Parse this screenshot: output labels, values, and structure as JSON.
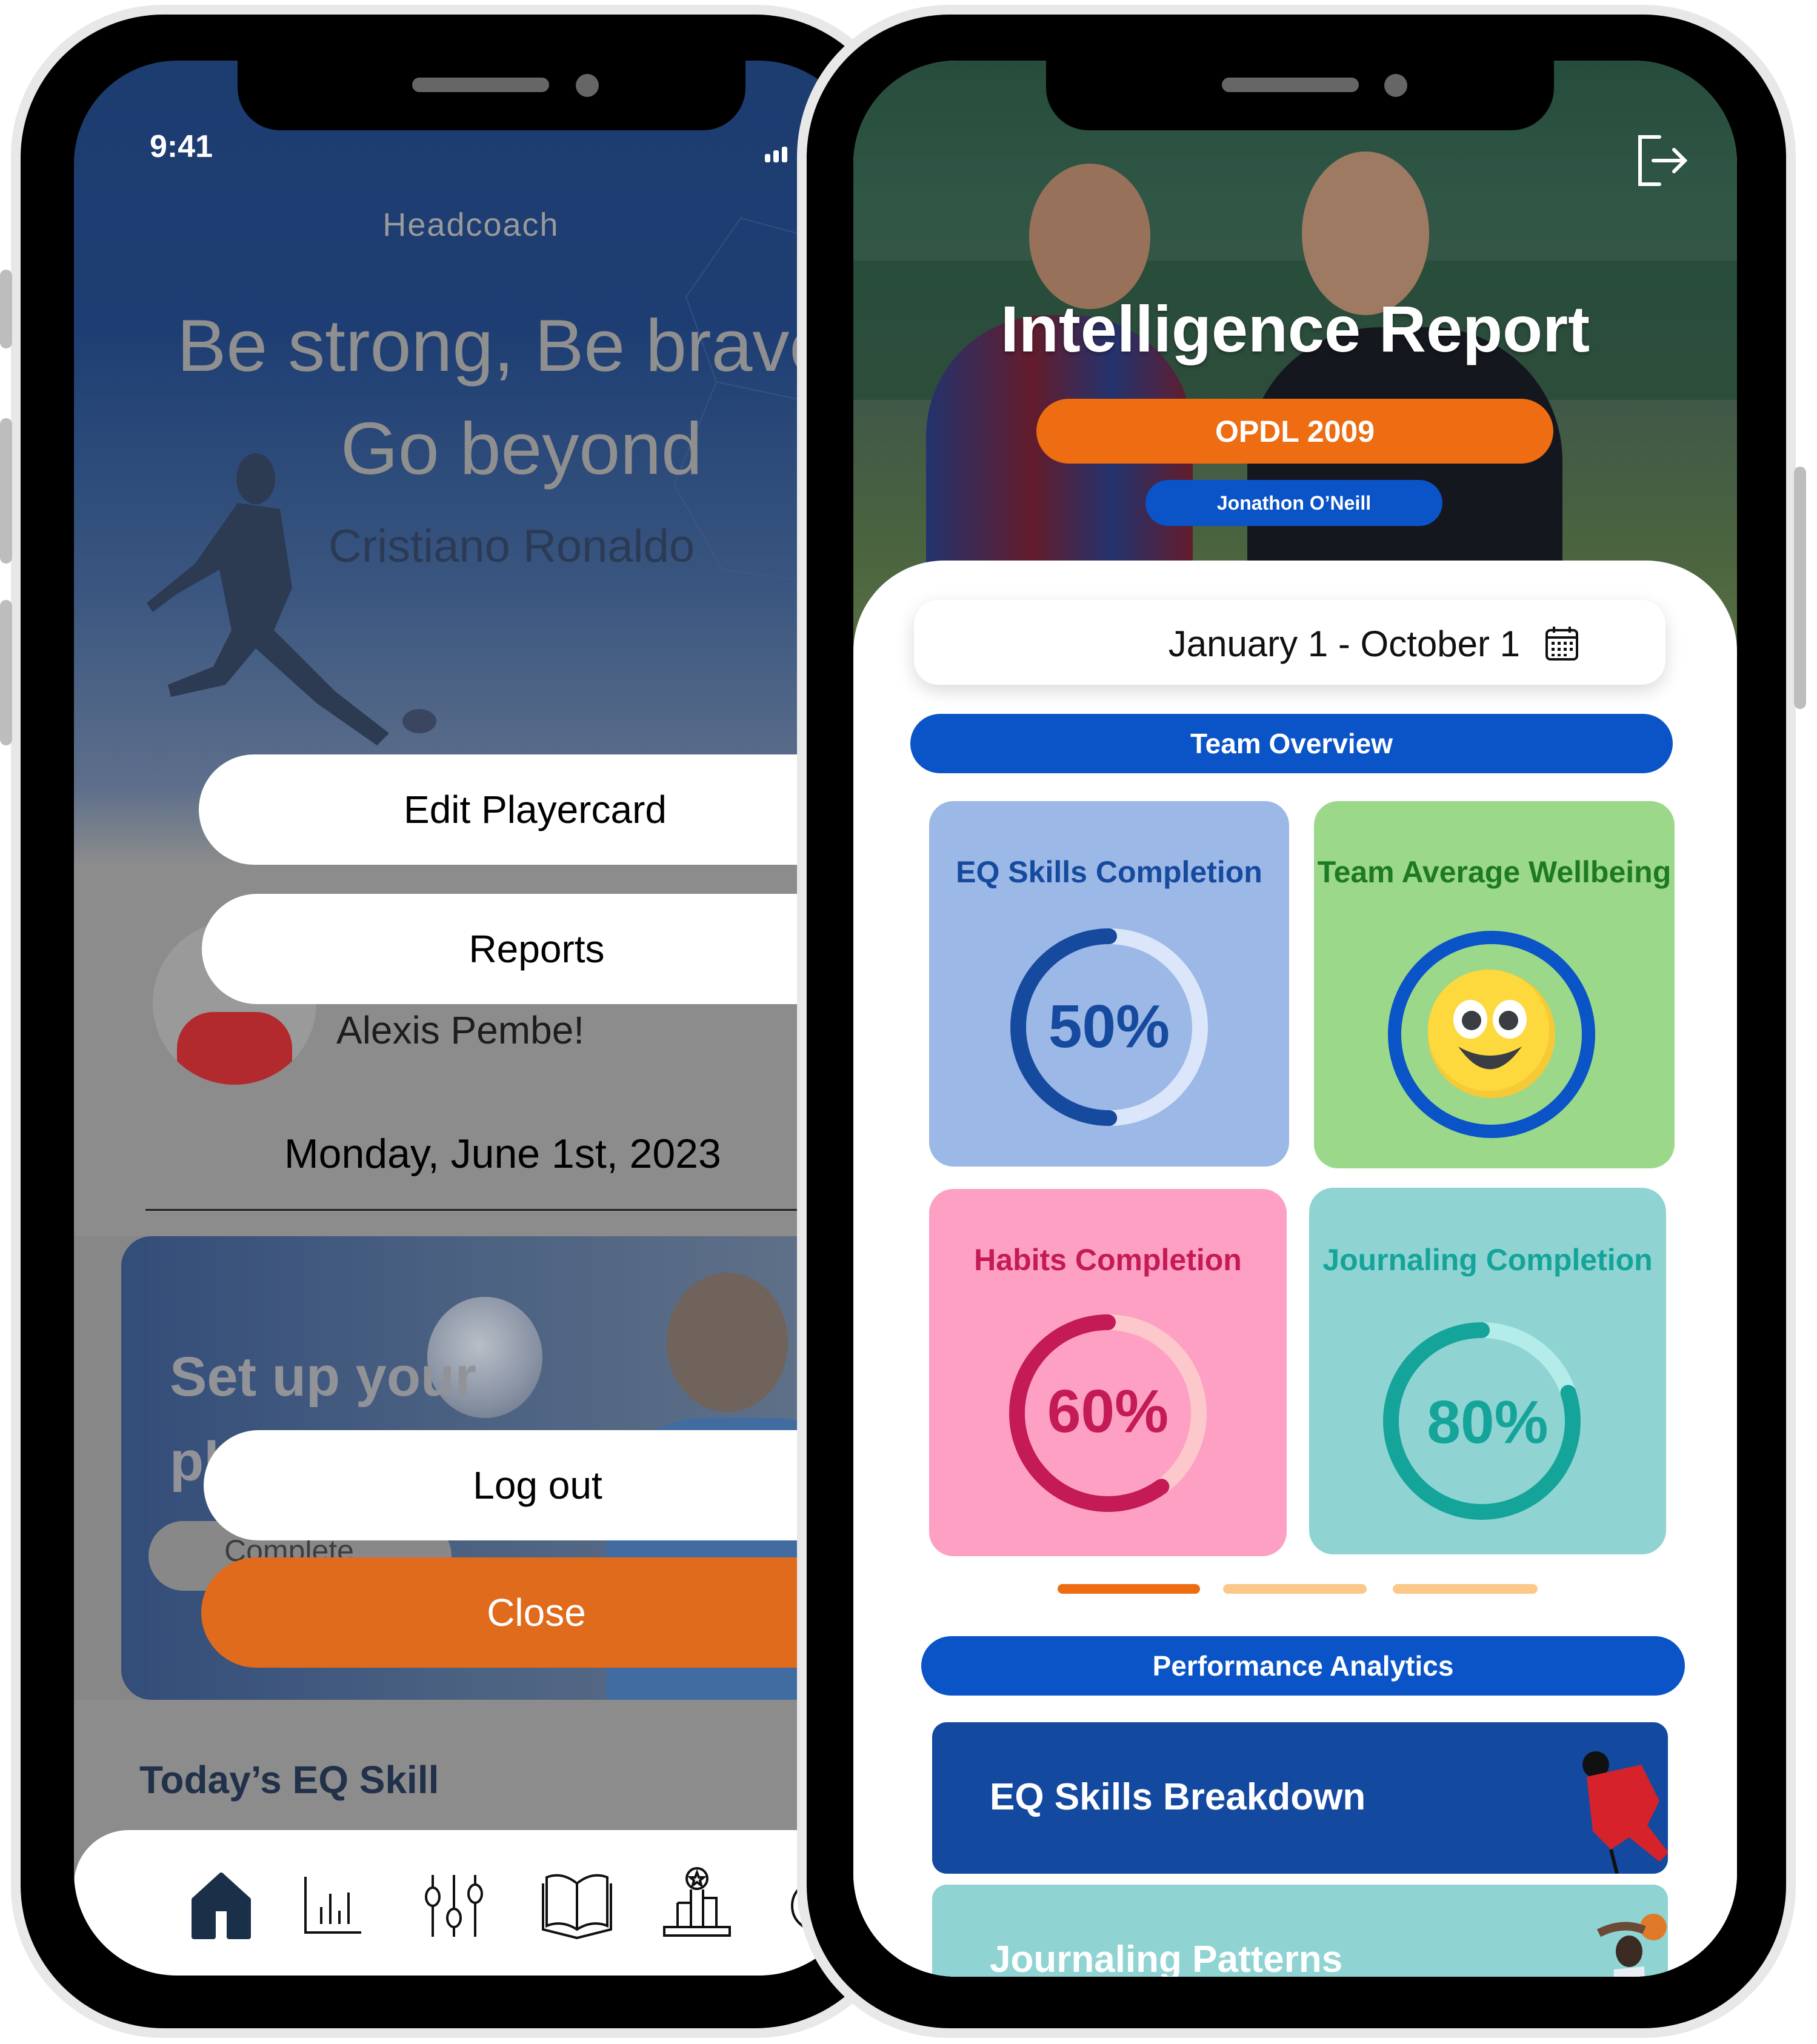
{
  "left_phone": {
    "status_bar": {
      "time": "9:41"
    },
    "header": {
      "role_label": "Headcoach"
    },
    "quote": {
      "line1": "Be strong, Be brave",
      "line2": "Go beyond",
      "author": "Cristiano Ronaldo"
    },
    "menu": {
      "edit_playercard": "Edit Playercard",
      "reports": "Reports",
      "log_out": "Log out",
      "close": "Close"
    },
    "player": {
      "greeting_name": "Alexis Pembe!"
    },
    "date": "Monday, June 1st, 2023",
    "setup_card": {
      "title_line1": "Set up your",
      "title_line2": "pl",
      "complete_label": "Complete"
    },
    "today_skill_heading": "Today’s EQ Skill",
    "bottom_nav": {
      "items": [
        {
          "icon": "home-icon",
          "active": true
        },
        {
          "icon": "bar-chart-icon",
          "active": false
        },
        {
          "icon": "sliders-icon",
          "active": false
        },
        {
          "icon": "book-icon",
          "active": false
        },
        {
          "icon": "podium-icon",
          "active": false
        },
        {
          "icon": "profile-icon",
          "active": false
        }
      ]
    }
  },
  "right_phone": {
    "header": {
      "title": "Intelligence Report",
      "team_badge": "OPDL 2009",
      "coach_badge": "Jonathon O’Neill",
      "logout_icon": "logout-icon"
    },
    "date_range": {
      "value": "January 1 - October 1",
      "icon": "calendar-icon"
    },
    "team_overview": {
      "heading": "Team Overview",
      "cards": [
        {
          "title": "EQ Skills Completion",
          "value_label": "50%",
          "value": 0.5,
          "bg": "#9bb8e6",
          "fg": "#164a9e",
          "track": "#dbe6fa"
        },
        {
          "title": "Team Average Wellbeing",
          "emoji": "smiling-face",
          "bg": "#9bd88a",
          "fg": "#1e7a22",
          "ring": "#0a54c8"
        },
        {
          "title": "Habits Completion",
          "value_label": "60%",
          "value": 0.6,
          "bg": "#fda0c3",
          "fg": "#c41a56",
          "track": "#fdc8cc"
        },
        {
          "title": "Journaling Completion",
          "value_label": "80%",
          "value": 0.8,
          "bg": "#8fd3d2",
          "fg": "#14a49a",
          "track": "#b3ece8"
        }
      ],
      "pager": {
        "count": 3,
        "active_index": 0,
        "active_color": "#ee6c12",
        "inactive_color": "#fcc88a"
      }
    },
    "performance_analytics": {
      "heading": "Performance Analytics",
      "items": [
        {
          "label": "EQ Skills Breakdown",
          "bg": "#1449a0"
        },
        {
          "label": "Journaling Patterns",
          "bg": "#8fd3d2"
        }
      ]
    },
    "colors": {
      "brand_blue": "#0a54c8",
      "brand_orange": "#ee6c12"
    }
  }
}
